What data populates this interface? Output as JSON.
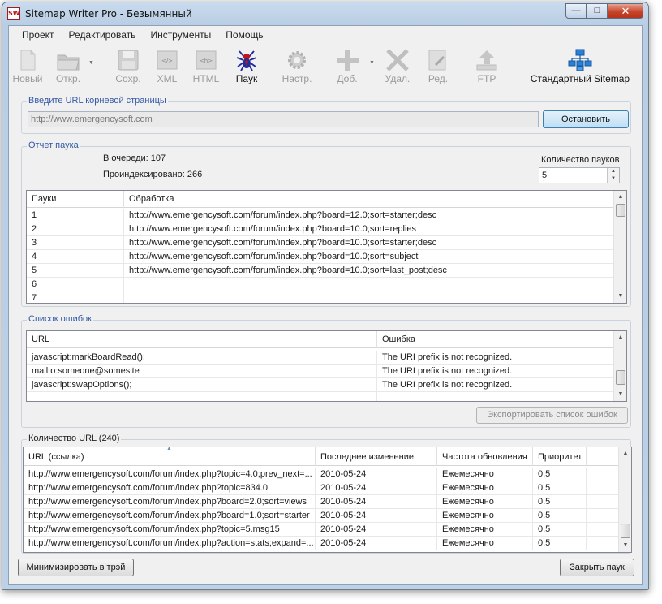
{
  "window": {
    "title": "Sitemap Writer Pro - Безымянный",
    "app_icon_text": "SW",
    "controls": {
      "minimize": "—",
      "maximize": "□",
      "close": "✕"
    }
  },
  "menu": [
    "Проект",
    "Редактировать",
    "Инструменты",
    "Помощь"
  ],
  "toolbar": {
    "new": "Новый",
    "open": "Откр.",
    "save": "Сохр.",
    "xml": "XML",
    "html": "HTML",
    "spider": "Паук",
    "settings": "Настр.",
    "add": "Доб.",
    "delete": "Удал.",
    "edit": "Ред.",
    "ftp": "FTP",
    "standard_sitemap": "Стандартный Sitemap",
    "icons": {
      "new": "new-document-icon",
      "open": "open-folder-icon",
      "save": "save-disk-icon",
      "xml": "xml-file-icon",
      "html": "html-file-icon",
      "spider": "spider-icon",
      "settings": "gear-icon",
      "add": "plus-icon",
      "delete": "x-icon",
      "edit": "edit-document-icon",
      "ftp": "ftp-upload-icon",
      "standard_sitemap": "sitemap-tree-icon"
    }
  },
  "root_url": {
    "group_title": "Введите URL корневой страницы",
    "value": "http://www.emergencysoft.com",
    "stop_button": "Остановить"
  },
  "spider_report": {
    "group_title": "Отчет паука",
    "queued": "В очереди: 107",
    "indexed": "Проиндексировано: 266",
    "spider_count_label": "Количество пауков",
    "spider_count_value": "5",
    "columns": [
      "Пауки",
      "Обработка"
    ],
    "rows": [
      [
        "1",
        "http://www.emergencysoft.com/forum/index.php?board=12.0;sort=starter;desc"
      ],
      [
        "2",
        "http://www.emergencysoft.com/forum/index.php?board=10.0;sort=replies"
      ],
      [
        "3",
        "http://www.emergencysoft.com/forum/index.php?board=10.0;sort=starter;desc"
      ],
      [
        "4",
        "http://www.emergencysoft.com/forum/index.php?board=10.0;sort=subject"
      ],
      [
        "5",
        "http://www.emergencysoft.com/forum/index.php?board=10.0;sort=last_post;desc"
      ],
      [
        "6",
        ""
      ],
      [
        "7",
        ""
      ]
    ]
  },
  "errors": {
    "group_title": "Список ошибок",
    "columns": [
      "URL",
      "Ошибка"
    ],
    "rows": [
      [
        "javascript:markBoardRead();",
        "The URI prefix is not recognized."
      ],
      [
        "mailto:someone@somesite",
        "The URI prefix is not recognized."
      ],
      [
        "javascript:swapOptions();",
        "The URI prefix is not recognized."
      ],
      [
        "",
        ""
      ]
    ],
    "export_button": "Экспортировать список ошибок"
  },
  "urls": {
    "group_title": "Количество URL (240)",
    "columns": [
      "URL (ссылка)",
      "Последнее изменение",
      "Частота обновления",
      "Приоритет"
    ],
    "rows": [
      [
        "http://www.emergencysoft.com/forum/index.php?topic=4.0;prev_next=...",
        "2010-05-24",
        "Ежемесячно",
        "0.5"
      ],
      [
        "http://www.emergencysoft.com/forum/index.php?topic=834.0",
        "2010-05-24",
        "Ежемесячно",
        "0.5"
      ],
      [
        "http://www.emergencysoft.com/forum/index.php?board=2.0;sort=views",
        "2010-05-24",
        "Ежемесячно",
        "0.5"
      ],
      [
        "http://www.emergencysoft.com/forum/index.php?board=1.0;sort=starter",
        "2010-05-24",
        "Ежемесячно",
        "0.5"
      ],
      [
        "http://www.emergencysoft.com/forum/index.php?topic=5.msg15",
        "2010-05-24",
        "Ежемесячно",
        "0.5"
      ],
      [
        "http://www.emergencysoft.com/forum/index.php?action=stats;expand=...",
        "2010-05-24",
        "Ежемесячно",
        "0.5"
      ]
    ]
  },
  "footer": {
    "minimize_tray": "Минимизировать в трэй",
    "close_spider": "Закрыть паук"
  }
}
